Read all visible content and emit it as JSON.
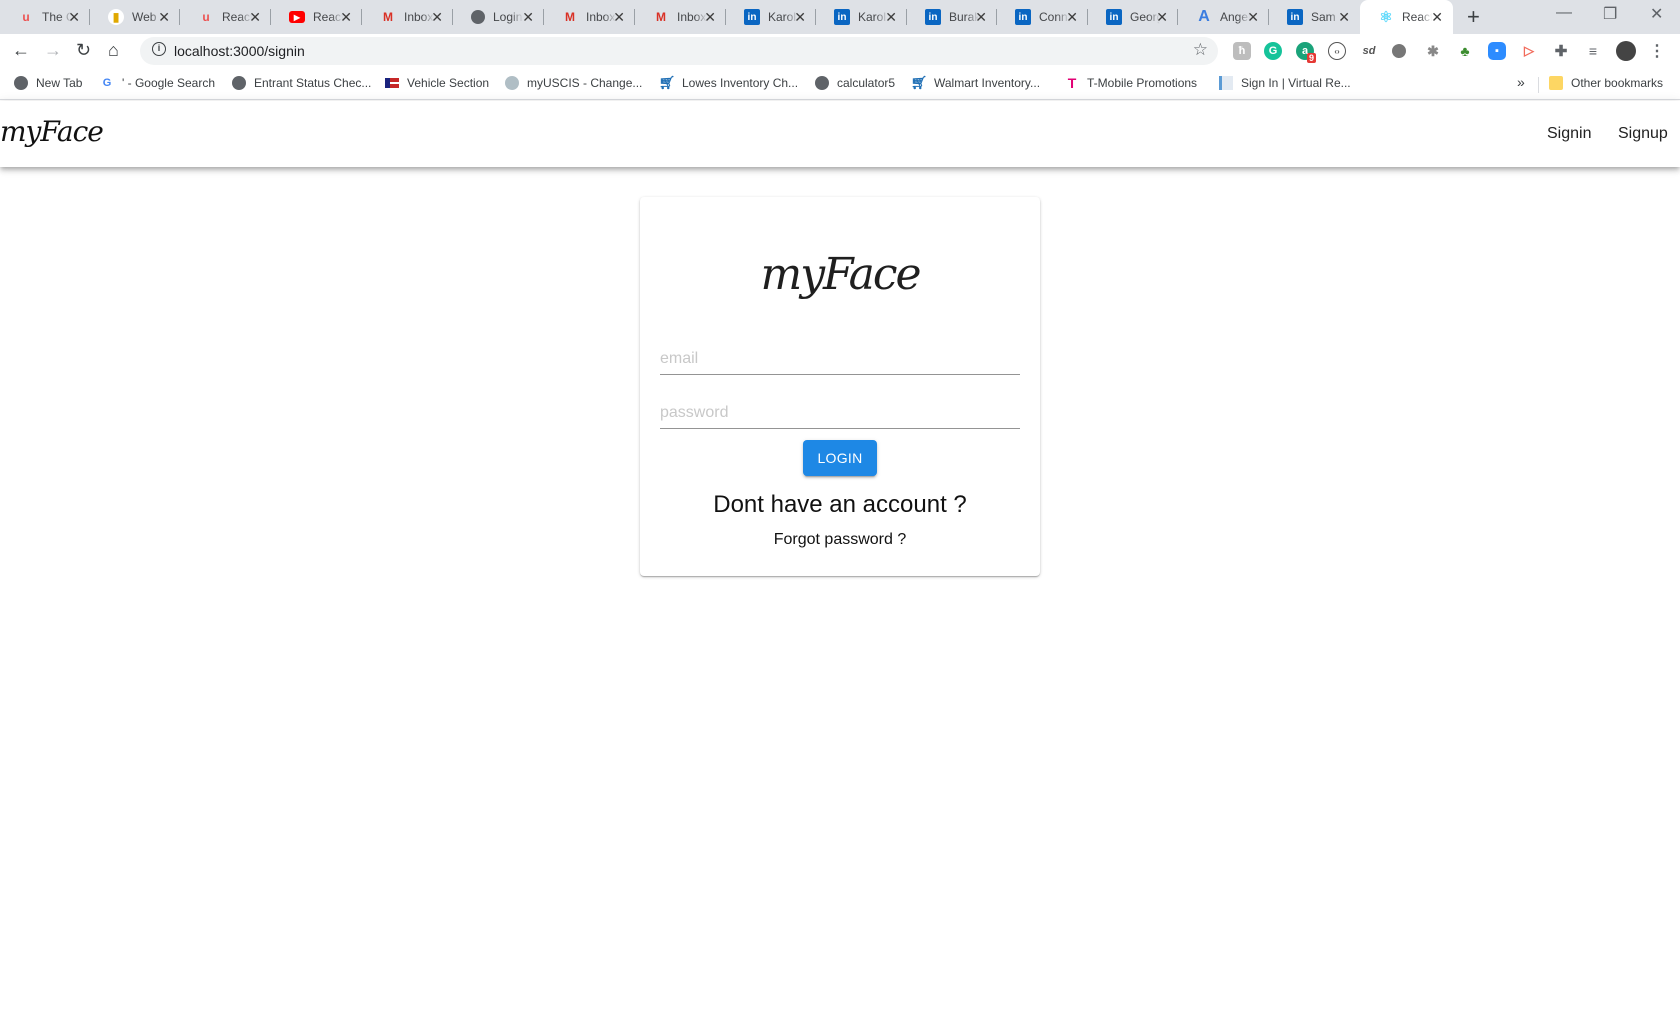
{
  "browser": {
    "tabs": [
      {
        "title": "The Complete",
        "icon": "udemy-icon",
        "active": false
      },
      {
        "title": "Web",
        "icon": "web-app-icon",
        "active": false
      },
      {
        "title": "React",
        "icon": "udemy-icon",
        "active": false
      },
      {
        "title": "React",
        "icon": "youtube-icon",
        "active": false
      },
      {
        "title": "Inbox",
        "icon": "gmail-icon",
        "active": false
      },
      {
        "title": "Login",
        "icon": "globe-icon",
        "active": false
      },
      {
        "title": "Inbox",
        "icon": "gmail-icon",
        "active": false
      },
      {
        "title": "Inbox",
        "icon": "gmail-icon",
        "active": false
      },
      {
        "title": "Karol",
        "icon": "linkedin-icon",
        "active": false
      },
      {
        "title": "Karol",
        "icon": "linkedin-icon",
        "active": false
      },
      {
        "title": "Burak",
        "icon": "linkedin-icon",
        "active": false
      },
      {
        "title": "Conn",
        "icon": "linkedin-icon",
        "active": false
      },
      {
        "title": "Georg",
        "icon": "linkedin-icon",
        "active": false
      },
      {
        "title": "Angel",
        "icon": "angel-icon",
        "active": false
      },
      {
        "title": "Sam",
        "icon": "linkedin-icon",
        "active": false
      },
      {
        "title": "React",
        "icon": "react-icon",
        "active": true
      }
    ],
    "new_tab": "+",
    "window_controls": {
      "minimize": "—",
      "restore": "❐",
      "close": "✕"
    },
    "url": "localhost:3000/signin",
    "extension_badge": "9",
    "bookmarks": [
      {
        "label": "New Tab",
        "icon": "globe-icon"
      },
      {
        "label": "' - Google Search",
        "icon": "google-icon"
      },
      {
        "label": "Entrant Status Chec...",
        "icon": "globe-icon"
      },
      {
        "label": "Vehicle Section",
        "icon": "flag-icon"
      },
      {
        "label": "myUSCIS - Change...",
        "icon": "dhs-seal-icon"
      },
      {
        "label": "Lowes Inventory Ch...",
        "icon": "cart-icon"
      },
      {
        "label": "calculator5",
        "icon": "globe-icon"
      },
      {
        "label": "Walmart Inventory...",
        "icon": "cart-icon"
      },
      {
        "label": "T-Mobile Promotions",
        "icon": "tmobile-icon"
      },
      {
        "label": "Sign In | Virtual Re...",
        "icon": "document-icon"
      }
    ],
    "bookmarks_overflow": "»",
    "other_bookmarks": "Other bookmarks"
  },
  "app": {
    "brand": "myFace",
    "nav": {
      "signin": "Signin",
      "signup": "Signup"
    },
    "card": {
      "logo": "myFace",
      "email": {
        "value": "",
        "placeholder": "email"
      },
      "password": {
        "value": "",
        "placeholder": "password"
      },
      "login_label": "LOGIN",
      "signup_prompt": "Dont have an account ?",
      "forgot_password": "Forgot password ?"
    }
  },
  "colors": {
    "primary": "#1e88e5",
    "tab_strip": "#dee1e6"
  }
}
